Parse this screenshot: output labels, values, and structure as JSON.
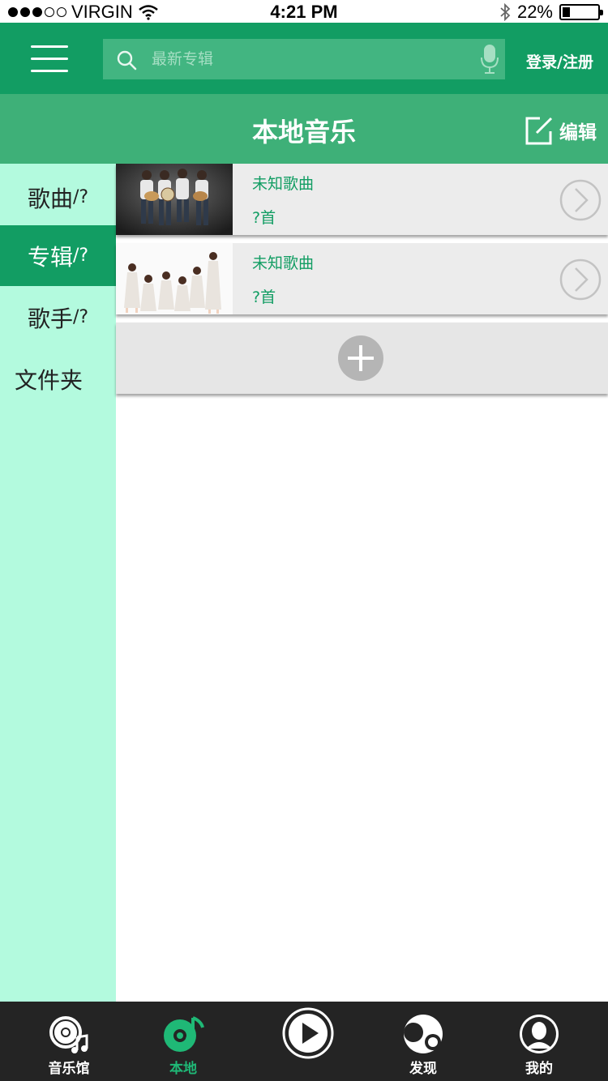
{
  "status_bar": {
    "carrier": "VIRGIN",
    "time": "4:21 PM",
    "battery": "22%",
    "battery_level": 0.22,
    "signal_bars_filled": 3,
    "signal_bars_total": 5
  },
  "header": {
    "search_placeholder": "最新专辑",
    "login_label": "登录/注册",
    "menu_icon": "hamburger-menu-icon",
    "search_icon": "search-icon",
    "mic_icon": "microphone-icon"
  },
  "title_bar": {
    "title": "本地音乐",
    "edit_label": "编辑",
    "edit_icon": "edit-icon"
  },
  "sidebar": {
    "items": [
      {
        "label": "歌曲",
        "count": "/?"
      },
      {
        "label": "专辑",
        "count": "/?"
      },
      {
        "label": "歌手",
        "count": "/?"
      },
      {
        "label": "文件夹",
        "count": ""
      }
    ],
    "active_index": 1
  },
  "albums": [
    {
      "title": "未知歌曲",
      "count": "?首"
    },
    {
      "title": "未知歌曲",
      "count": "?首"
    }
  ],
  "tab_bar": {
    "tabs": [
      {
        "label": "音乐馆",
        "icon": "music-hall-icon"
      },
      {
        "label": "本地",
        "icon": "local-music-icon"
      },
      {
        "label": "",
        "icon": "play-icon"
      },
      {
        "label": "发现",
        "icon": "discover-icon"
      },
      {
        "label": "我的",
        "icon": "profile-icon"
      }
    ],
    "active_index": 1
  },
  "colors": {
    "primary_green": "#129d63",
    "title_green": "#3eb078",
    "sidebar_bg": "#b3fade",
    "tab_bar_bg": "#242424"
  }
}
